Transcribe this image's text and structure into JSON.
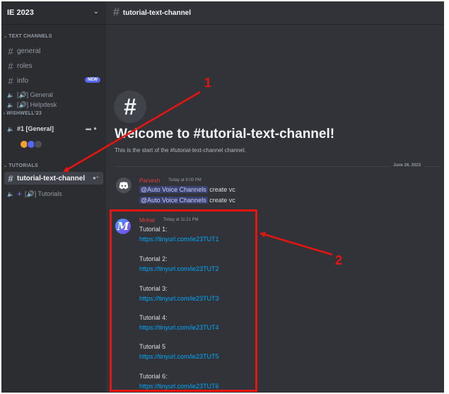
{
  "server": {
    "name": "IE 2023"
  },
  "sidebar": {
    "categories": {
      "text": "TEXT CHANNELS",
      "wishwell": "WISHWELL'23",
      "tutorials": "TUTORIALS"
    },
    "channels": {
      "general": "general",
      "roles": "roles",
      "info": "info",
      "info_badge": "NEW",
      "voice_general": "[🔊] General",
      "voice_helpdesk": "[🔊] Helpdesk",
      "wish_general": "#1 [General]",
      "tutorial_text": "tutorial-text-channel",
      "voice_tutorials": "[🔊] Tutorials"
    }
  },
  "header": {
    "channel": "tutorial-text-channel"
  },
  "welcome": {
    "title": "Welcome to #tutorial-text-channel!",
    "subtitle": "This is the start of the #tutorial-text-channel channel."
  },
  "divider": {
    "date": "June 26, 2023"
  },
  "messages": [
    {
      "author": "Parvesh",
      "time": "Today at 9:00 PM",
      "lines": [
        {
          "mention": "@Auto Voice Channels",
          "text": "create vc"
        },
        {
          "mention": "@Auto Voice Channels",
          "text": "create vc"
        }
      ]
    },
    {
      "author": "Mrinal",
      "time": "Today at 11:21 PM",
      "avatar_letter": "M",
      "tutorials": [
        {
          "label": "Tutorial 1:",
          "url": "https://tinyurl.com/ie23TUT1"
        },
        {
          "label": "Tutorial 2:",
          "url": "https://tinyurl.com/ie23TUT2"
        },
        {
          "label": "Tutorial 3:",
          "url": "https://tinyurl.com/ie23TUT3"
        },
        {
          "label": "Tutorial 4:",
          "url": "https://tinyurl.com/ie23TUT4"
        },
        {
          "label": "Tutorial 5",
          "url": "https://tinyurl.com/ie23TUT5"
        },
        {
          "label": "Tutorial 6:",
          "url": "https://tinyurl.com/ie23TUT6"
        }
      ]
    }
  ],
  "annotations": {
    "one": "1",
    "two": "2"
  },
  "icons": {
    "server_chevron": "chevron-down-icon",
    "hash": "hash-icon",
    "speaker": "speaker-icon",
    "add_member": "add-member-icon",
    "discord": "discord-logo-icon"
  },
  "colors": {
    "annotation_red": "#e8140f",
    "link": "#00a8fc",
    "mention_bg": "#3c4270",
    "username": "#e23f3f",
    "badge": "#5865f2"
  }
}
